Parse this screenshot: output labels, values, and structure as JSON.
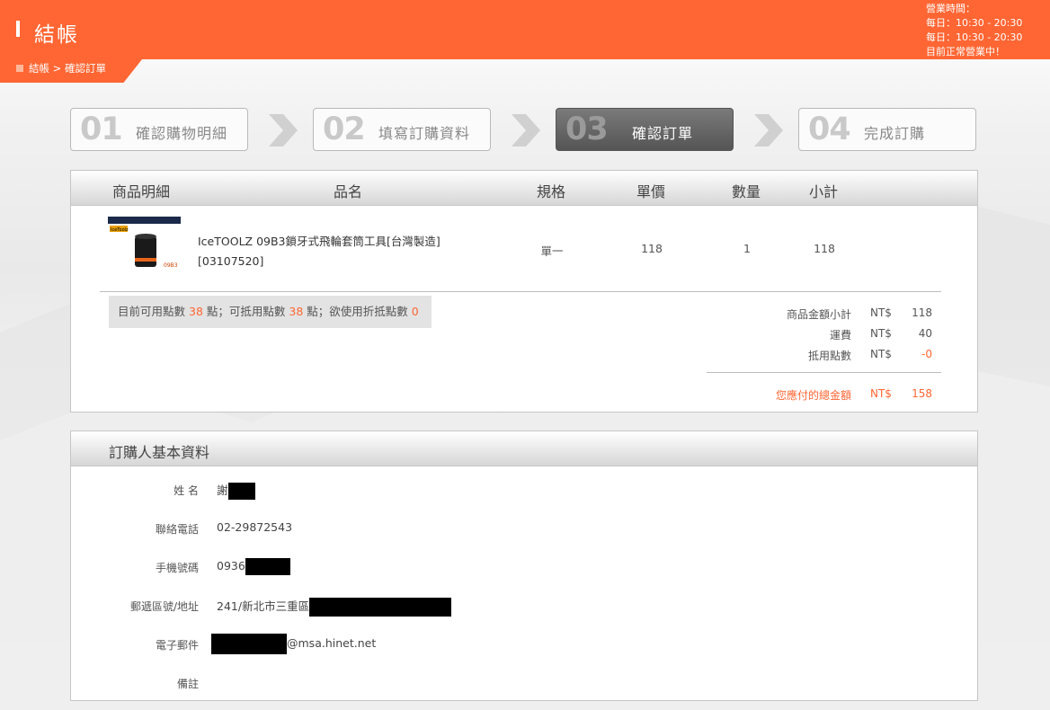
{
  "header": {
    "title": "結帳",
    "breadcrumb": "結帳 > 確認訂單"
  },
  "hours": {
    "line1": "營業時間：",
    "line2": "每日：10:30 - 20:30",
    "line3": "每日：10:30 - 20:30",
    "line4": "目前正常營業中！"
  },
  "steps": [
    {
      "num": "01",
      "label": "確認購物明細"
    },
    {
      "num": "02",
      "label": "填寫訂購資料"
    },
    {
      "num": "03",
      "label": "確認訂單"
    },
    {
      "num": "04",
      "label": "完成訂購"
    }
  ],
  "cart": {
    "headers": {
      "detail": "商品明細",
      "name": "品名",
      "spec": "規格",
      "price": "單價",
      "qty": "數量",
      "subtotal": "小計"
    },
    "item": {
      "name_line1": "IceTOOLZ 09B3鎖牙式飛輪套筒工具[台灣製造]",
      "name_line2": "[03107520]",
      "spec": "單一",
      "price": "118",
      "qty": "1",
      "subtotal": "118",
      "img_brand": "IceToolz",
      "img_code": "09B3"
    },
    "points": {
      "t1": "目前可用點數",
      "v1": "38",
      "t2": "點；可抵用點數",
      "v2": "38",
      "t3": "點；欲使用折抵點數",
      "v3": "0"
    },
    "summary": {
      "currency": "NT$",
      "subtotal_label": "商品金額小計",
      "subtotal": "118",
      "shipping_label": "運費",
      "shipping": "40",
      "points_label": "抵用點數",
      "points": "-0",
      "total_label": "您應付的總金額",
      "total": "158"
    }
  },
  "buyer": {
    "title": "訂購人基本資料",
    "name_label": "姓 名",
    "name": "謝",
    "phone_label": "聯絡電話",
    "phone": "02-29872543",
    "mobile_label": "手機號碼",
    "mobile": "0936",
    "address_label": "郵遞區號/地址",
    "address": "241/新北市三重區",
    "email_label": "電子郵件",
    "email": "@msa.hinet.net",
    "note_label": "備註"
  },
  "colors": {
    "accent": "#ff6633",
    "step_active": "#666666"
  }
}
